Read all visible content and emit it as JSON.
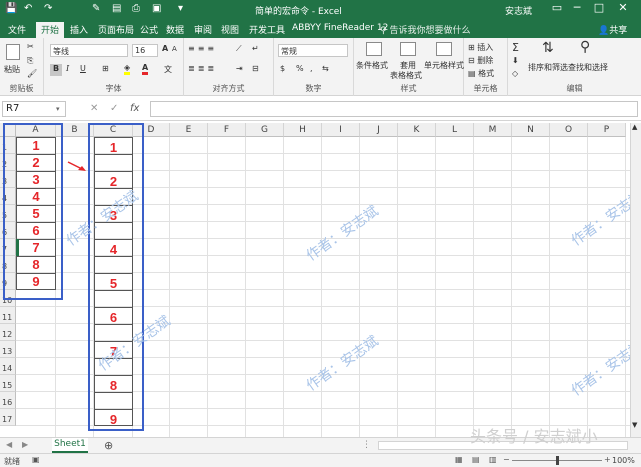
{
  "window": {
    "title": "简单的宏命令 - Excel",
    "user": "安志斌",
    "share": "共享",
    "tell_me": "告诉我你想要做什么",
    "controls": [
      "─",
      "□",
      "✕"
    ]
  },
  "tabs": [
    "开始",
    "插入",
    "页面布局",
    "公式",
    "数据",
    "审阅",
    "视图",
    "开发工具",
    "ABBYY FineReader 12"
  ],
  "file_tab": "文件",
  "ribbon": {
    "clipboard": {
      "label": "剪贴板",
      "paste": "粘贴"
    },
    "font": {
      "label": "字体",
      "name": "等线",
      "size": "16",
      "bold": "B",
      "italic": "I",
      "underline": "U",
      "grow": "A",
      "shrink": "A",
      "color": "A",
      "wen": "文"
    },
    "alignment": {
      "label": "对齐方式"
    },
    "number": {
      "label": "数字",
      "format": "常规",
      "percent": "%",
      "comma": ","
    },
    "styles": {
      "label": "样式",
      "conditional": "条件格式",
      "table1": "套用",
      "table2": "表格格式",
      "cell_styles": "单元格样式"
    },
    "cells": {
      "label": "单元格",
      "insert": "插入",
      "delete": "删除",
      "format": "格式"
    },
    "editing": {
      "label": "编辑",
      "sort": "排序和筛选",
      "find": "查找和选择",
      "sigma": "Σ"
    }
  },
  "formula_bar": {
    "name_box": "R7",
    "cancel": "✕",
    "enter": "✓",
    "fx": "fx"
  },
  "columns": [
    "A",
    "B",
    "C",
    "D",
    "E",
    "F",
    "G",
    "H",
    "I",
    "J",
    "K",
    "L",
    "M",
    "N",
    "O",
    "P"
  ],
  "rows": [
    "1",
    "2",
    "3",
    "4",
    "5",
    "6",
    "7",
    "8",
    "9",
    "10",
    "11",
    "12",
    "13",
    "14",
    "15",
    "16",
    "17"
  ],
  "colA_values": [
    "1",
    "2",
    "3",
    "4",
    "5",
    "6",
    "7",
    "8",
    "9"
  ],
  "colC_values": [
    "1",
    "2",
    "3",
    "4",
    "5",
    "6",
    "7",
    "8",
    "9"
  ],
  "watermark": "作者：安志斌",
  "sheet_tab": "Sheet1",
  "add_sheet": "⊕",
  "status": {
    "ready": "就绪",
    "zoom": "100%"
  },
  "corner_watermark": "头条号 / 安志斌小"
}
